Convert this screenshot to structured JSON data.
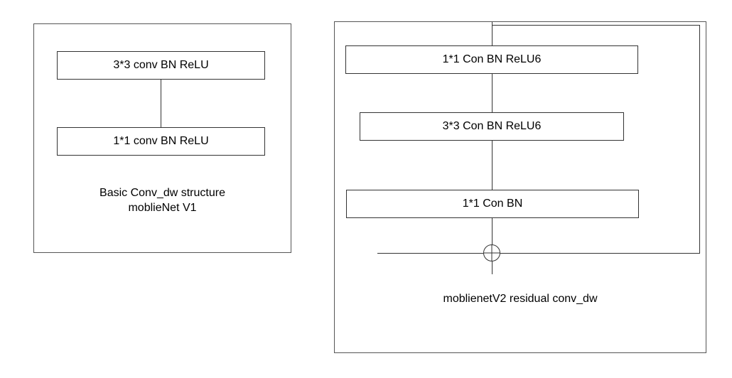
{
  "left": {
    "block1": "3*3 conv BN ReLU",
    "block2": "1*1 conv BN ReLU",
    "caption_line1": "Basic Conv_dw structure",
    "caption_line2": "moblieNet V1"
  },
  "right": {
    "block1": "1*1 Con BN ReLU6",
    "block2": "3*3 Con BN ReLU6",
    "block3": "1*1 Con BN",
    "caption": "moblienetV2 residual conv_dw"
  }
}
